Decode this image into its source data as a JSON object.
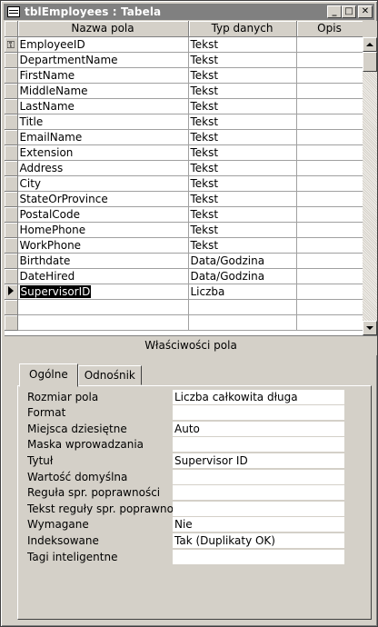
{
  "window": {
    "title": "tblEmployees : Tabela",
    "minimize": "_",
    "maximize": "□",
    "close": "✕"
  },
  "grid": {
    "columns": [
      "Nazwa pola",
      "Typ danych",
      "Opis"
    ],
    "rows": [
      {
        "marker": "key",
        "name": "EmployeeID",
        "type": "Tekst",
        "desc": ""
      },
      {
        "marker": "",
        "name": "DepartmentName",
        "type": "Tekst",
        "desc": ""
      },
      {
        "marker": "",
        "name": "FirstName",
        "type": "Tekst",
        "desc": ""
      },
      {
        "marker": "",
        "name": "MiddleName",
        "type": "Tekst",
        "desc": ""
      },
      {
        "marker": "",
        "name": "LastName",
        "type": "Tekst",
        "desc": ""
      },
      {
        "marker": "",
        "name": "Title",
        "type": "Tekst",
        "desc": ""
      },
      {
        "marker": "",
        "name": "EmailName",
        "type": "Tekst",
        "desc": ""
      },
      {
        "marker": "",
        "name": "Extension",
        "type": "Tekst",
        "desc": ""
      },
      {
        "marker": "",
        "name": "Address",
        "type": "Tekst",
        "desc": ""
      },
      {
        "marker": "",
        "name": "City",
        "type": "Tekst",
        "desc": ""
      },
      {
        "marker": "",
        "name": "StateOrProvince",
        "type": "Tekst",
        "desc": ""
      },
      {
        "marker": "",
        "name": "PostalCode",
        "type": "Tekst",
        "desc": ""
      },
      {
        "marker": "",
        "name": "HomePhone",
        "type": "Tekst",
        "desc": ""
      },
      {
        "marker": "",
        "name": "WorkPhone",
        "type": "Tekst",
        "desc": ""
      },
      {
        "marker": "",
        "name": "Birthdate",
        "type": "Data/Godzina",
        "desc": ""
      },
      {
        "marker": "",
        "name": "DateHired",
        "type": "Data/Godzina",
        "desc": ""
      },
      {
        "marker": "current",
        "name": "SupervisorID",
        "type": "Liczba",
        "desc": ""
      },
      {
        "marker": "",
        "name": "",
        "type": "",
        "desc": ""
      },
      {
        "marker": "",
        "name": "",
        "type": "",
        "desc": ""
      }
    ]
  },
  "properties": {
    "header": "Właściwości pola",
    "tabs": [
      "Ogólne",
      "Odnośnik"
    ],
    "active_tab": "Ogólne",
    "fields": [
      {
        "label": "Rozmiar pola",
        "value": "Liczba całkowita długa"
      },
      {
        "label": "Format",
        "value": ""
      },
      {
        "label": "Miejsca dziesiętne",
        "value": "Auto"
      },
      {
        "label": "Maska wprowadzania",
        "value": ""
      },
      {
        "label": "Tytuł",
        "value": "Supervisor ID"
      },
      {
        "label": "Wartość domyślna",
        "value": ""
      },
      {
        "label": "Reguła spr. poprawności",
        "value": ""
      },
      {
        "label": "Tekst reguły spr. poprawności",
        "value": ""
      },
      {
        "label": "Wymagane",
        "value": "Nie"
      },
      {
        "label": "Indeksowane",
        "value": "Tak (Duplikaty OK)"
      },
      {
        "label": "Tagi inteligentne",
        "value": ""
      }
    ]
  }
}
